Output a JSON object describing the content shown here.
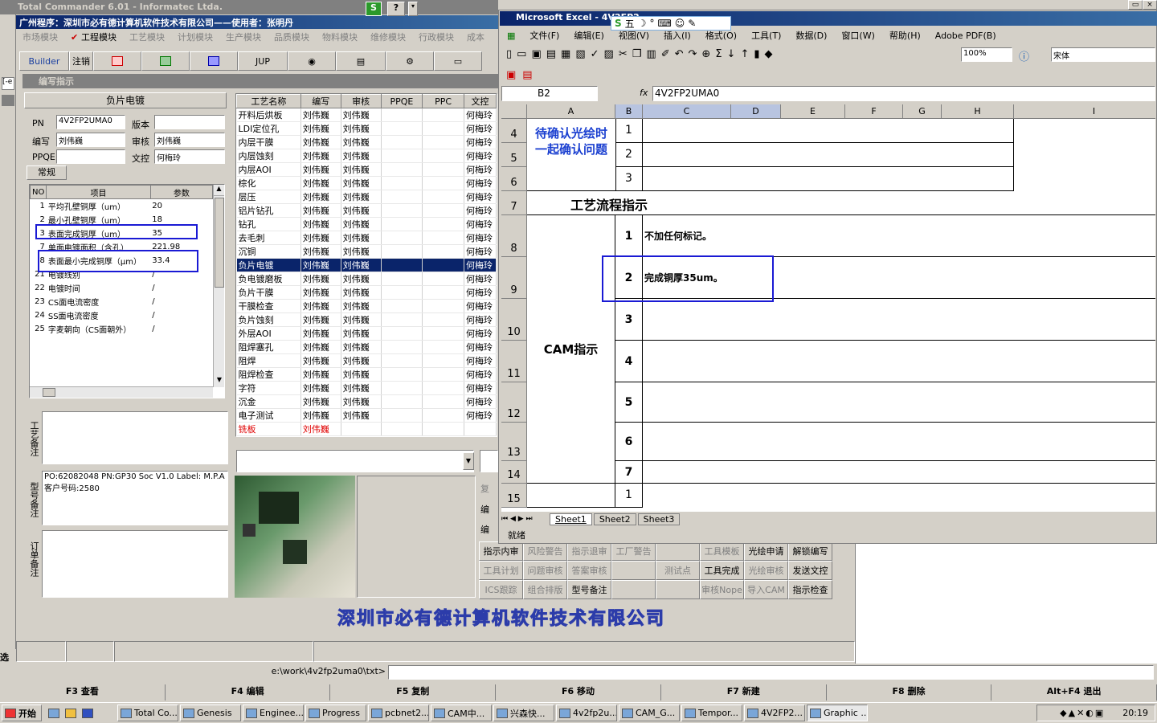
{
  "tc": {
    "title": "Total Commander 6.01 - Informatec Ltda.",
    "app_title": "广州程序：深圳市必有德计算机软件技术有限公司——使用者：张明丹",
    "modules": [
      "市场模块",
      "工程模块",
      "工艺模块",
      "计划模块",
      "生产模块",
      "品质模块",
      "物料模块",
      "维修模块",
      "行政模块",
      "成本"
    ],
    "toolbar": {
      "builder": "Builder",
      "logout": "注销",
      "jup": "JUP"
    },
    "inner_title": "编写指示",
    "panel_header": "负片电镀",
    "fields": {
      "pn_label": "PN",
      "pn_value": "4V2FP2UMA0",
      "version_label": "版本",
      "version_value": "",
      "writer_label": "编写",
      "writer_value": "刘伟巍",
      "reviewer_label": "审核",
      "reviewer_value": "刘伟巍",
      "ppqe_label": "PPQE",
      "ppqe_value": "",
      "control_label": "文控",
      "control_value": "何梅玲"
    },
    "tab_general": "常规",
    "param_cols": [
      "NO",
      "项目",
      "参数"
    ],
    "params": [
      {
        "no": "1",
        "item": "平均孔壁铜厚（um）",
        "val": "20"
      },
      {
        "no": "2",
        "item": "最小孔壁铜厚（um）",
        "val": "18"
      },
      {
        "no": "3",
        "item": "表面完成铜厚（um）",
        "val": "35"
      },
      {
        "no": "7",
        "item": "单面电镀面积（含孔）",
        "val": "221.98"
      },
      {
        "no": "8",
        "item": "表面最小完成铜厚（μm）",
        "val": "33.4"
      },
      {
        "no": "21",
        "item": "电镀线别",
        "val": "/"
      },
      {
        "no": "22",
        "item": "电镀时间",
        "val": "/"
      },
      {
        "no": "23",
        "item": "CS面电流密度",
        "val": "/"
      },
      {
        "no": "24",
        "item": "SS面电流密度",
        "val": "/"
      },
      {
        "no": "25",
        "item": "字麦朝向（CS面朝外）",
        "val": "/"
      }
    ],
    "notes": {
      "craft_label": "工艺备注",
      "craft_text": "",
      "model_label": "型号备注",
      "model_text": "PO:62082048 PN:GP30 Soc V1.0 Label: M.P.A\n客户号码:2580",
      "order_label": "订单备注",
      "order_text": ""
    },
    "proc_cols": [
      "工艺名称",
      "编写",
      "审核",
      "PPQE",
      "PPC",
      "文控"
    ],
    "proc_rows": [
      [
        "开料后烘板",
        "刘伟巍",
        "刘伟巍",
        "",
        "",
        "何梅玲"
      ],
      [
        "LDI定位孔",
        "刘伟巍",
        "刘伟巍",
        "",
        "",
        "何梅玲"
      ],
      [
        "内层干膜",
        "刘伟巍",
        "刘伟巍",
        "",
        "",
        "何梅玲"
      ],
      [
        "内层蚀刻",
        "刘伟巍",
        "刘伟巍",
        "",
        "",
        "何梅玲"
      ],
      [
        "内层AOI",
        "刘伟巍",
        "刘伟巍",
        "",
        "",
        "何梅玲"
      ],
      [
        "棕化",
        "刘伟巍",
        "刘伟巍",
        "",
        "",
        "何梅玲"
      ],
      [
        "层压",
        "刘伟巍",
        "刘伟巍",
        "",
        "",
        "何梅玲"
      ],
      [
        "铝片钻孔",
        "刘伟巍",
        "刘伟巍",
        "",
        "",
        "何梅玲"
      ],
      [
        "钻孔",
        "刘伟巍",
        "刘伟巍",
        "",
        "",
        "何梅玲"
      ],
      [
        "去毛刺",
        "刘伟巍",
        "刘伟巍",
        "",
        "",
        "何梅玲"
      ],
      [
        "沉铜",
        "刘伟巍",
        "刘伟巍",
        "",
        "",
        "何梅玲"
      ],
      [
        "负片电镀",
        "刘伟巍",
        "刘伟巍",
        "",
        "",
        "何梅玲"
      ],
      [
        "负电镀磨板",
        "刘伟巍",
        "刘伟巍",
        "",
        "",
        "何梅玲"
      ],
      [
        "负片干膜",
        "刘伟巍",
        "刘伟巍",
        "",
        "",
        "何梅玲"
      ],
      [
        "干膜检查",
        "刘伟巍",
        "刘伟巍",
        "",
        "",
        "何梅玲"
      ],
      [
        "负片蚀刻",
        "刘伟巍",
        "刘伟巍",
        "",
        "",
        "何梅玲"
      ],
      [
        "外层AOI",
        "刘伟巍",
        "刘伟巍",
        "",
        "",
        "何梅玲"
      ],
      [
        "阻焊塞孔",
        "刘伟巍",
        "刘伟巍",
        "",
        "",
        "何梅玲"
      ],
      [
        "阻焊",
        "刘伟巍",
        "刘伟巍",
        "",
        "",
        "何梅玲"
      ],
      [
        "阻焊检查",
        "刘伟巍",
        "刘伟巍",
        "",
        "",
        "何梅玲"
      ],
      [
        "字符",
        "刘伟巍",
        "刘伟巍",
        "",
        "",
        "何梅玲"
      ],
      [
        "沉金",
        "刘伟巍",
        "刘伟巍",
        "",
        "",
        "何梅玲"
      ],
      [
        "电子测试",
        "刘伟巍",
        "刘伟巍",
        "",
        "",
        "何梅玲"
      ],
      [
        "铣板",
        "刘伟巍",
        "",
        "",
        "",
        ""
      ]
    ],
    "side_buttons": [
      "复",
      "编",
      "编"
    ],
    "action_buttons": [
      "指示内审",
      "风险警告",
      "指示退审",
      "工厂警告",
      "",
      "工具模板",
      "光绘申请",
      "解锁编写",
      "工具计划",
      "问题审核",
      "答案审核",
      "",
      "测试点",
      "工具完成",
      "光绘审核",
      "发送文控",
      "ICS跟踪",
      "组合排版",
      "型号备注",
      "",
      "",
      "审核Nope",
      "导入CAM",
      "指示检查"
    ],
    "watermark": "深圳市必有德计算机软件技术有限公司",
    "path": "e:\\work\\4v2fp2uma0\\txt>",
    "fkeys": [
      "F3 查看",
      "F4 编辑",
      "F5 复制",
      "F6 移动",
      "F7 新建",
      "F8 删除",
      "Alt+F4 退出"
    ]
  },
  "excel": {
    "title": "Microsoft Excel - 4V2FP2",
    "menu": [
      "文件(F)",
      "编辑(E)",
      "视图(V)",
      "插入(I)",
      "格式(O)",
      "工具(T)",
      "数据(D)",
      "窗口(W)",
      "帮助(H)",
      "Adobe PDF(B)"
    ],
    "zoom": "100%",
    "font": "宋体",
    "namebox": "B2",
    "formula": "4V2FP2UMA0",
    "cols": [
      "A",
      "B",
      "C",
      "D",
      "E",
      "F",
      "G",
      "H",
      "I"
    ],
    "rows": [
      "4",
      "5",
      "6",
      "7",
      "8",
      "9",
      "10",
      "11",
      "12",
      "13",
      "14",
      "15"
    ],
    "a_note": "待确认光绘时一起确认问题",
    "flow_title": "工艺流程指示",
    "cam_title": "CAM指示",
    "b_nums": [
      "1",
      "2",
      "3",
      "1",
      "2",
      "3",
      "4",
      "5",
      "6",
      "7",
      "1"
    ],
    "c8": "不加任何标记。",
    "c9": "完成铜厚35um。",
    "sheets": [
      "Sheet1",
      "Sheet2",
      "Sheet3"
    ],
    "status": "就绪"
  },
  "taskbar": {
    "start": "开始",
    "tasks": [
      "Total Co...",
      "Genesis",
      "Enginee...",
      "Progress",
      "pcbnet2...",
      "CAM中...",
      "兴森快...",
      "4v2fp2u...",
      "CAM_G...",
      "Tempor...",
      "4V2FP2...",
      "Graphic ..."
    ],
    "clock": "20:19"
  }
}
